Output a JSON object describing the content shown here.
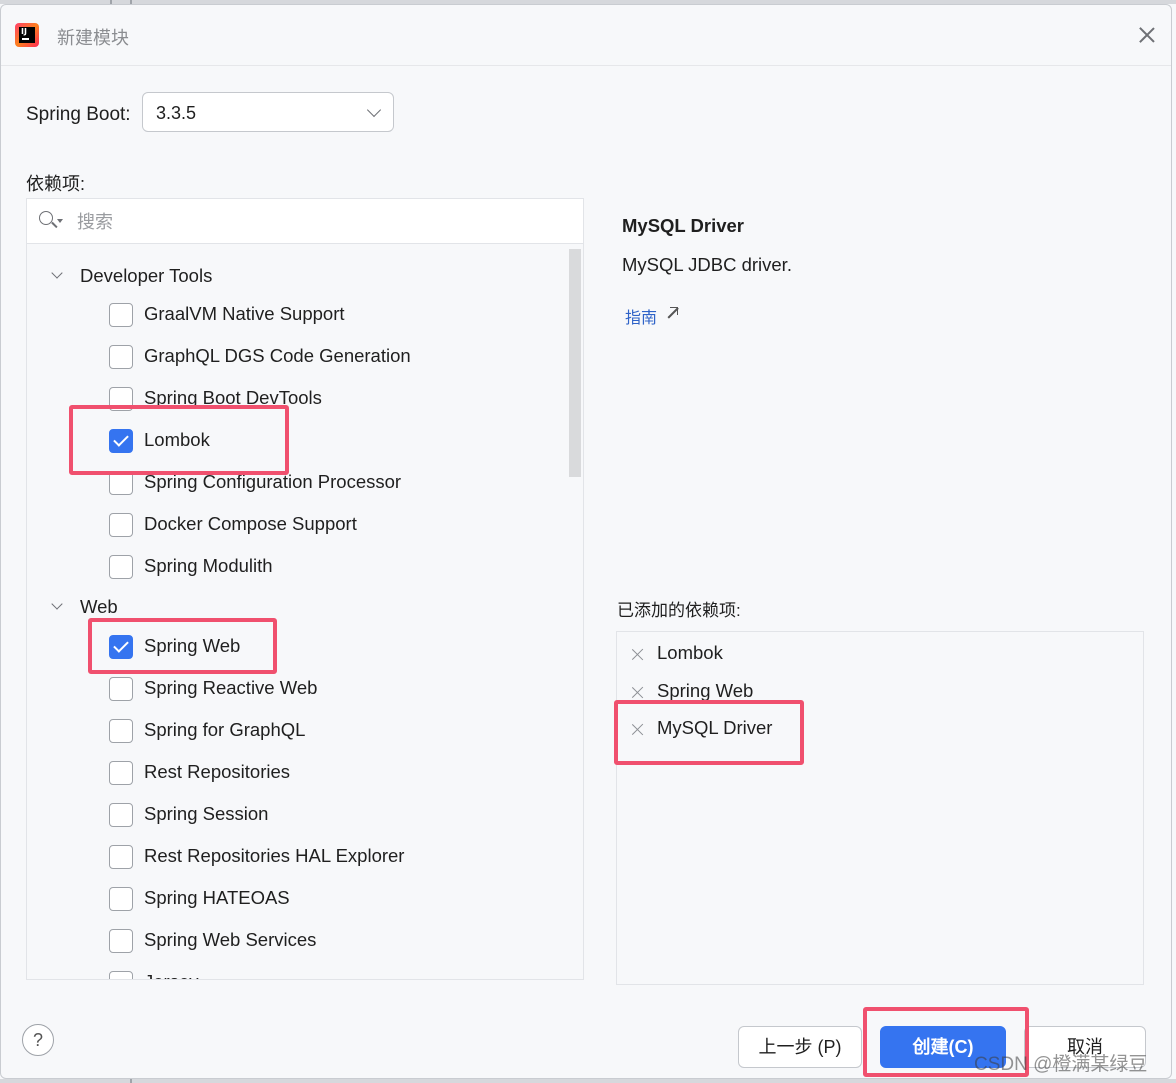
{
  "window": {
    "title": "新建模块"
  },
  "spring_boot": {
    "label": "Spring Boot:",
    "selected": "3.3.5"
  },
  "dependencies": {
    "label": "依赖项:",
    "search_placeholder": "搜索",
    "groups": [
      {
        "name": "Developer Tools",
        "items": [
          {
            "label": "GraalVM Native Support",
            "checked": false
          },
          {
            "label": "GraphQL DGS Code Generation",
            "checked": false
          },
          {
            "label": "Spring Boot DevTools",
            "checked": false
          },
          {
            "label": "Lombok",
            "checked": true
          },
          {
            "label": "Spring Configuration Processor",
            "checked": false
          },
          {
            "label": "Docker Compose Support",
            "checked": false
          },
          {
            "label": "Spring Modulith",
            "checked": false
          }
        ]
      },
      {
        "name": "Web",
        "items": [
          {
            "label": "Spring Web",
            "checked": true
          },
          {
            "label": "Spring Reactive Web",
            "checked": false
          },
          {
            "label": "Spring for GraphQL",
            "checked": false
          },
          {
            "label": "Rest Repositories",
            "checked": false
          },
          {
            "label": "Spring Session",
            "checked": false
          },
          {
            "label": "Rest Repositories HAL Explorer",
            "checked": false
          },
          {
            "label": "Spring HATEOAS",
            "checked": false
          },
          {
            "label": "Spring Web Services",
            "checked": false
          },
          {
            "label": "Jersey",
            "checked": false
          }
        ]
      }
    ]
  },
  "info": {
    "name": "MySQL Driver",
    "description": "MySQL JDBC driver.",
    "guide_link": "指南"
  },
  "added": {
    "label": "已添加的依赖项:",
    "items": [
      "Lombok",
      "Spring Web",
      "MySQL Driver"
    ]
  },
  "buttons": {
    "help": "?",
    "prev": "上一步 (P)",
    "create": "创建(C)",
    "cancel": "取消"
  },
  "watermark": "CSDN @橙满某绿豆",
  "colors": {
    "accent": "#3574f0",
    "highlight": "#f0506e",
    "background": "#f7f8fa"
  }
}
